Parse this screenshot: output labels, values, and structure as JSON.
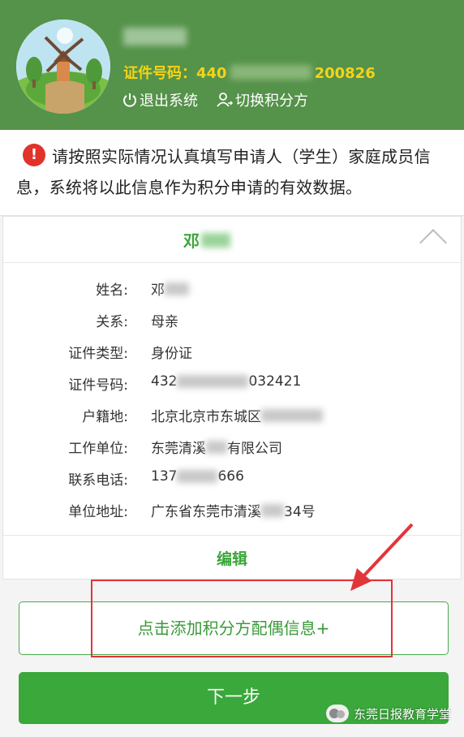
{
  "header": {
    "id_label": "证件号码：",
    "id_prefix": "440",
    "id_suffix": "200826",
    "logout_label": "退出系统",
    "switch_label": "切换积分方"
  },
  "notice": {
    "text": "请按照实际情况认真填写申请人（学生）家庭成员信息，系统将以此信息作为积分申请的有效数据。"
  },
  "member": {
    "name": "邓",
    "fields": [
      {
        "label": "姓名:",
        "value": "邓",
        "masked": true
      },
      {
        "label": "关系:",
        "value": "母亲",
        "masked": false
      },
      {
        "label": "证件类型:",
        "value": "身份证",
        "masked": false
      },
      {
        "label": "证件号码:",
        "value": "432",
        "value_end": "032421",
        "masked": true
      },
      {
        "label": "户籍地:",
        "value": "北京北京市东城区",
        "masked": true
      },
      {
        "label": "工作单位:",
        "value": "东莞清溪",
        "value_end": "有限公司",
        "masked": true
      },
      {
        "label": "联系电话:",
        "value": "137",
        "value_end": "666",
        "masked": true
      },
      {
        "label": "单位地址:",
        "value": "广东省东莞市清溪",
        "value_end": "34号",
        "masked": true
      }
    ],
    "edit_label": "编辑"
  },
  "actions": {
    "add_spouse_label": "点击添加积分方配偶信息+",
    "next_label": "下一步"
  },
  "watermark": {
    "text": "东莞日报教育学堂"
  },
  "colors": {
    "header_green": "#55924a",
    "accent_green": "#3aa83a",
    "id_yellow": "#f5d316",
    "highlight_red": "#e2353a"
  }
}
